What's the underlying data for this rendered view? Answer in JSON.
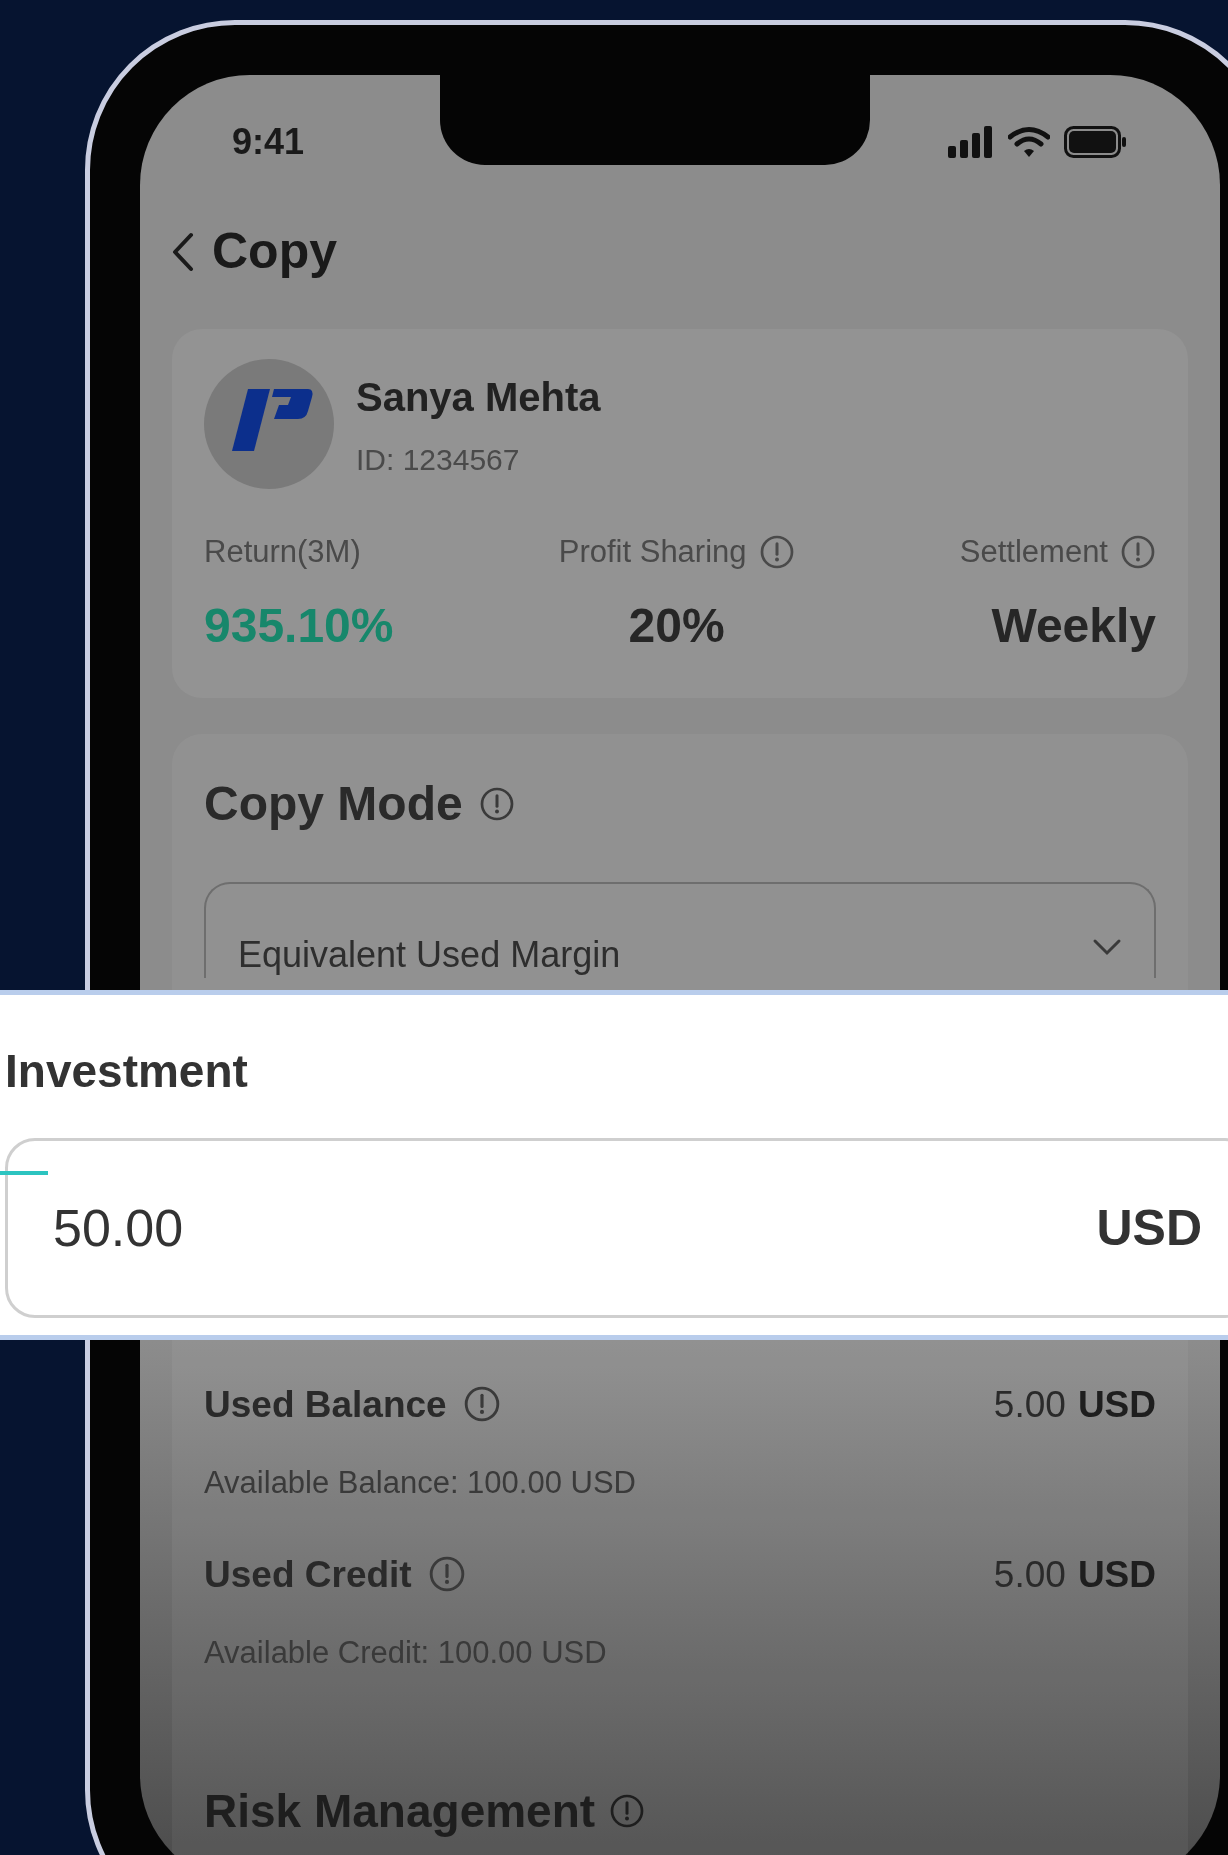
{
  "status_bar": {
    "time": "9:41"
  },
  "header": {
    "title": "Copy"
  },
  "trader": {
    "name": "Sanya Mehta",
    "id": "ID: 1234567",
    "stats": [
      {
        "label": "Return(3M)",
        "value": "935.10%",
        "info": false,
        "kind": "gain"
      },
      {
        "label": "Profit Sharing",
        "value": "20%",
        "info": true,
        "kind": "plain"
      },
      {
        "label": "Settlement",
        "value": "Weekly",
        "info": true,
        "kind": "plain"
      }
    ]
  },
  "copy_mode": {
    "title": "Copy Mode",
    "selected_option": "Equivalent Used Margin"
  },
  "investment": {
    "label": "Investment",
    "value": "50.00",
    "currency": "USD"
  },
  "usage": [
    {
      "label": "Used Balance",
      "amount": "5.00",
      "currency": "USD",
      "note": "Available Balance: 100.00 USD"
    },
    {
      "label": "Used Credit",
      "amount": "5.00",
      "currency": "USD",
      "note": "Available Credit: 100.00 USD"
    }
  ],
  "risk_management": {
    "title": "Risk Management"
  }
}
